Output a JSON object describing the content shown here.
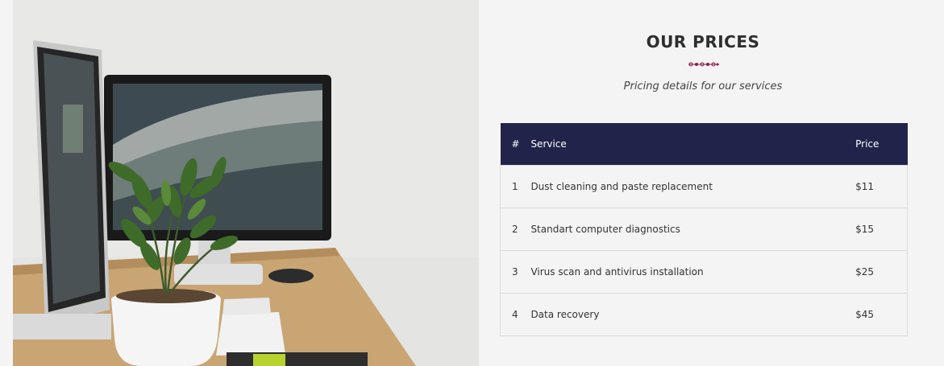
{
  "pricing": {
    "title": "OUR PRICES",
    "subtitle": "Pricing details for our services",
    "accent_color": "#8b1a4a",
    "header_color": "#22234b",
    "table": {
      "columns": [
        "#",
        "Service",
        "Price"
      ],
      "rows": [
        {
          "num": "1",
          "service": "Dust cleaning and paste replacement",
          "price": "$11"
        },
        {
          "num": "2",
          "service": "Standart computer diagnostics",
          "price": "$15"
        },
        {
          "num": "3",
          "service": "Virus scan and antivirus installation",
          "price": "$25"
        },
        {
          "num": "4",
          "service": "Data recovery",
          "price": "$45"
        }
      ]
    }
  },
  "photo": {
    "subject": "desk-with-monitors-and-plant-image"
  }
}
